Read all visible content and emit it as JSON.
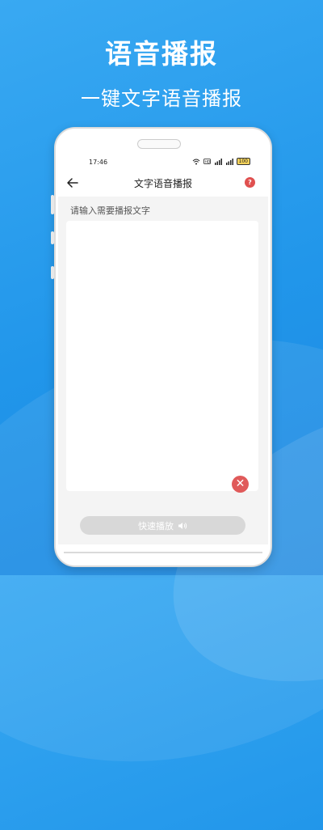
{
  "promo": {
    "title": "语音播报",
    "subtitle": "一键文字语音播报"
  },
  "status_bar": {
    "time": "17:46",
    "battery": "100",
    "icons": [
      "wifi-icon",
      "hd-icon",
      "signal-icon",
      "signal-icon",
      "battery-icon"
    ]
  },
  "app_bar": {
    "back_icon": "arrow-left-icon",
    "title": "文字语音播报",
    "help_label": "?"
  },
  "editor": {
    "label": "请输入需要播报文字",
    "value": "",
    "clear_icon": "close-icon"
  },
  "play_button": {
    "label": "快速播放",
    "icon": "speaker-icon"
  }
}
